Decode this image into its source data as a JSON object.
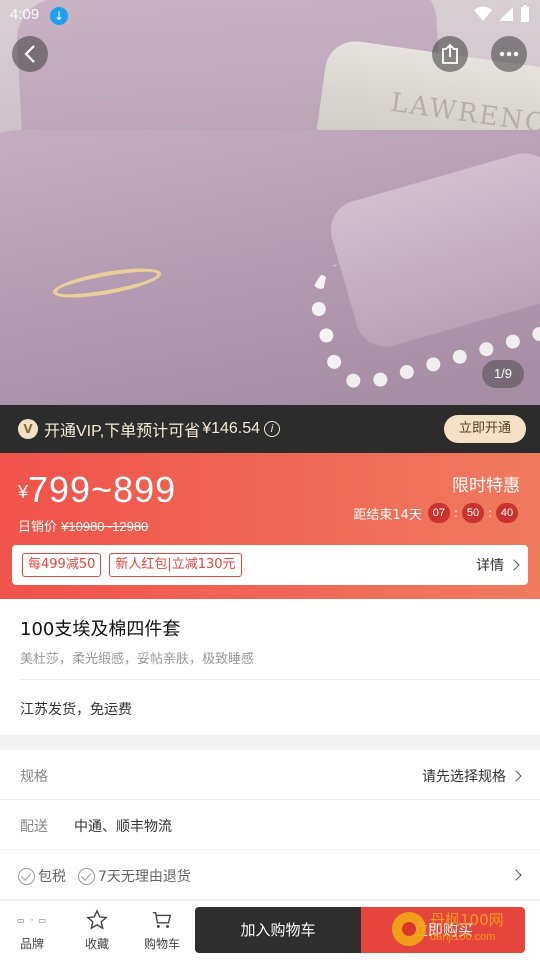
{
  "status_bar": {
    "time": "4:09"
  },
  "gallery": {
    "counter": "1/9",
    "pillow_print": "LAWRENCE"
  },
  "vip_bar": {
    "text": "开通VIP,下单预计可省",
    "amount": "¥146.54",
    "button": "立即开通"
  },
  "price_panel": {
    "currency": "¥",
    "price_range": "799~899",
    "daily_label": "日销价",
    "daily_price": "¥10980~12980",
    "promo_title": "限时特惠",
    "countdown_label": "距结束14天",
    "countdown": {
      "hours": "07",
      "minutes": "50",
      "seconds": "40"
    },
    "coupons": [
      "每499减50",
      "新人红包|立减130元"
    ],
    "detail_link": "详情"
  },
  "product": {
    "title": "100支埃及棉四件套",
    "subtitle": "美杜莎，柔光缎感，妥帖亲肤，极致睡感",
    "shipping_note": "江苏发货，免运费"
  },
  "rows": {
    "spec_label": "规格",
    "spec_value": "请先选择规格",
    "delivery_label": "配送",
    "delivery_value": "中通、顺丰物流",
    "guarantees": [
      "包税",
      "7天无理由退货"
    ]
  },
  "bottom_bar": {
    "brand_label": "品牌",
    "favorite_label": "收藏",
    "cart_label": "购物车",
    "add_to_cart": "加入购物车",
    "buy_now": "立即购买"
  },
  "watermark": {
    "main": "丹枫100网",
    "url": "danji100.com"
  },
  "colors": {
    "accent_red": "#e5453d",
    "vip_dark": "#2c2c2c",
    "vip_gold": "#f5e1c6",
    "price_gradient_start": "#f0534a",
    "price_gradient_end": "#f07a5e"
  }
}
